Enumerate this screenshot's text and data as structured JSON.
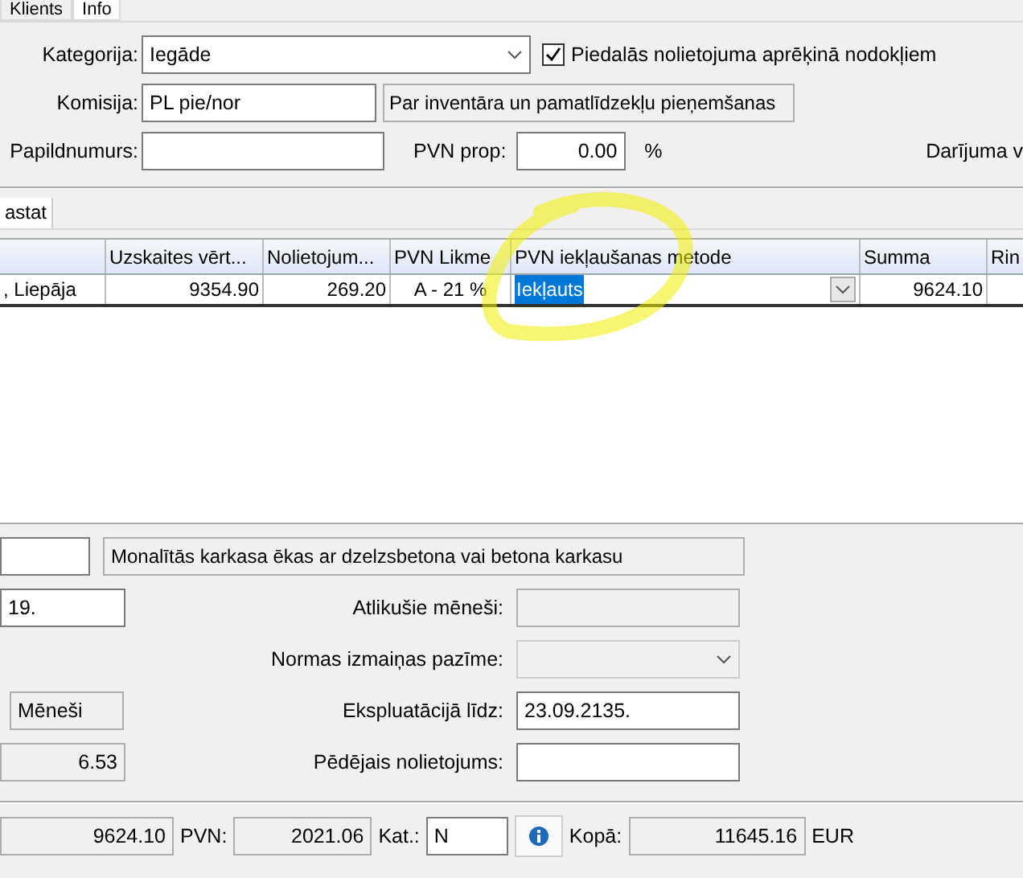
{
  "tabs": [
    {
      "label": "Klients",
      "selected": false
    },
    {
      "label": "Info",
      "selected": true
    }
  ],
  "info": {
    "category": {
      "label": "Kategorija:",
      "value": "Iegāde"
    },
    "tax_checkbox": {
      "label": "Piedalās nolietojuma aprēķinā nodokļiem",
      "checked": true
    },
    "commission": {
      "label": "Komisija:",
      "value": "PL pie/nor",
      "description": "Par inventāra un pamatlīdzekļu pieņemšanas"
    },
    "extra_number": {
      "label": "Papildnumurs:"
    },
    "vat_prop": {
      "label": "PVN prop:",
      "value": "0.00",
      "unit": "%"
    },
    "deal_label": "Darījuma v"
  },
  "subtabs": [
    {
      "label": "astat",
      "selected": true
    }
  ],
  "table": {
    "columns": [
      "",
      "Uzskaites vērt...",
      "Nolietojum...",
      "PVN Likme",
      "PVN iekļaušanas metode",
      "Summa",
      "Rin"
    ],
    "rows": [
      {
        "cells": [
          ", Liepāja",
          "9354.90",
          "269.20",
          "A - 21 %",
          "Iekļauts",
          "9624.10",
          ""
        ],
        "selected": true
      }
    ]
  },
  "details": {
    "group_description": "Monalītās karkasa ēkas ar dzelzsbetona vai betona karkasu",
    "date_partial": "19.",
    "remaining_months": {
      "label": "Atlikušie mēneši:"
    },
    "norm_change": {
      "label": "Normas izmaiņas pazīme:",
      "disabled": true
    },
    "period_unit": "Mēneši",
    "in_use_until": {
      "label": "Ekspluatācijā līdz:",
      "value": "23.09.2135."
    },
    "rate": "6.53",
    "last_depreciation": {
      "label": "Pēdējais nolietojums:"
    }
  },
  "totals": {
    "sum": "9624.10",
    "vat_label": "PVN:",
    "vat": "2021.06",
    "cat_label": "Kat.:",
    "cat": "N",
    "total_label": "Kopā:",
    "total": "11645.16",
    "currency": "EUR"
  }
}
